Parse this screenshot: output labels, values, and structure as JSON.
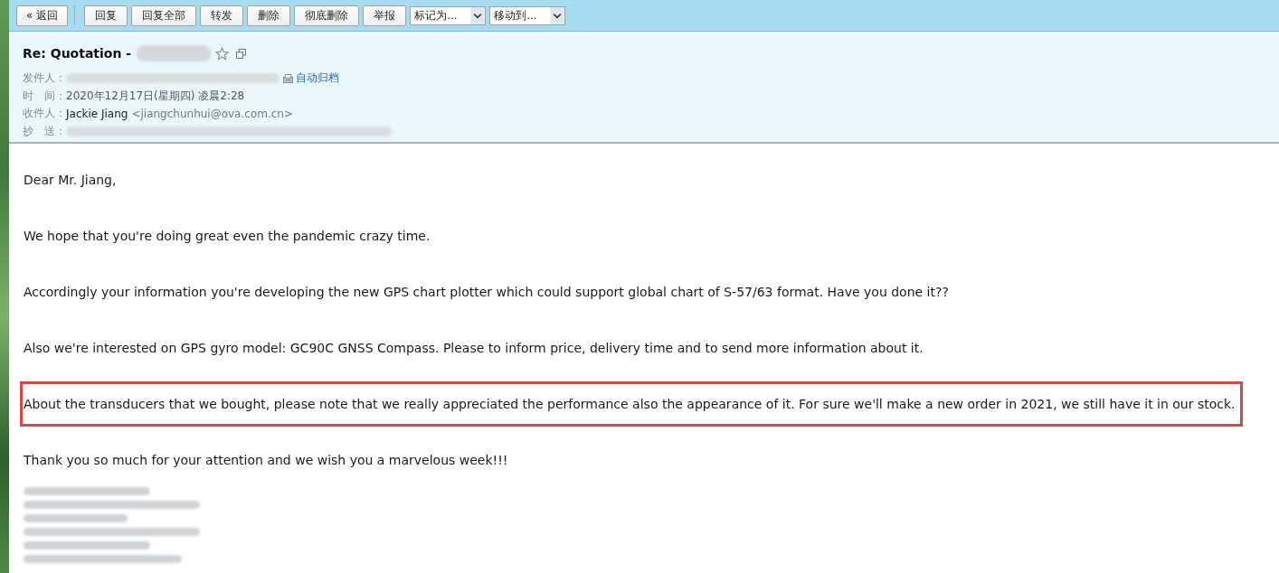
{
  "toolbar": {
    "back_button": "« 返回",
    "buttons": [
      "回复",
      "回复全部",
      "转发",
      "删除",
      "彻底删除",
      "举报"
    ],
    "dropdowns": [
      {
        "value": "标记为..."
      },
      {
        "value": "移动到..."
      }
    ]
  },
  "header": {
    "subject": "Re: Quotation -",
    "subject_redacted": true,
    "starred": false,
    "fields": [
      {
        "kind": "redacted",
        "label": "发件人：",
        "link": "自动归档"
      },
      {
        "kind": "text",
        "label": "时　间：",
        "value": "2020年12月17日(星期四) 凌晨2:28"
      },
      {
        "kind": "contact",
        "label": "收件人：",
        "name": "Jackie Jiang",
        "email": "<jiangchunhui@ova.com.cn>"
      },
      {
        "kind": "redacted",
        "label": "抄　送："
      }
    ]
  },
  "body": {
    "paragraphs": [
      {
        "text": "Dear Mr. Jiang,",
        "highlighted": false
      },
      {
        "text": "We hope that you're doing great even the pandemic crazy time.",
        "highlighted": false
      },
      {
        "text": "Accordingly your information you're developing the new GPS chart plotter which could support global chart of S-57/63 format. Have you done it??",
        "highlighted": false
      },
      {
        "text": "Also we're interested on GPS gyro model: GC90C GNSS Compass. Please to inform price, delivery time and to send more information about it.",
        "highlighted": false
      },
      {
        "text": "About the transducers that we bought, please note that we really appreciated the performance also the appearance of it. For sure we'll make a new order in 2021, we still have it in our stock.",
        "highlighted": true
      },
      {
        "text": "Thank you so much for your attention and we wish you a marvelous week!!!",
        "highlighted": false
      }
    ],
    "signature": [
      {
        "kind": "redacted"
      },
      {
        "kind": "redacted"
      },
      {
        "kind": "redacted"
      },
      {
        "kind": "redacted"
      },
      {
        "kind": "redacted"
      },
      {
        "kind": "redacted"
      }
    ]
  }
}
